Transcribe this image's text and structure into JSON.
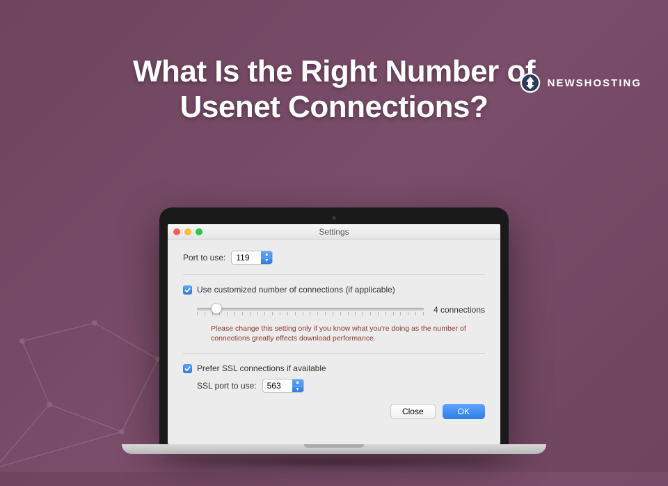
{
  "brand": {
    "name": "NEWSHOSTING"
  },
  "headline": {
    "line1": "What Is the Right Number of",
    "line2": "Usenet Connections?"
  },
  "window": {
    "title": "Settings",
    "port": {
      "label": "Port to use:",
      "value": "119"
    },
    "custom_conn": {
      "checkbox_label": "Use customized number of connections (if applicable)",
      "checked": true,
      "slider_value_label": "4 connections",
      "warning": "Please change this setting only if you know what you're doing as the number of connections greatly effects download performance."
    },
    "ssl": {
      "prefer_label": "Prefer SSL connections if available",
      "checked": true,
      "port_label": "SSL port to use:",
      "port_value": "563"
    },
    "buttons": {
      "close": "Close",
      "ok": "OK"
    }
  }
}
